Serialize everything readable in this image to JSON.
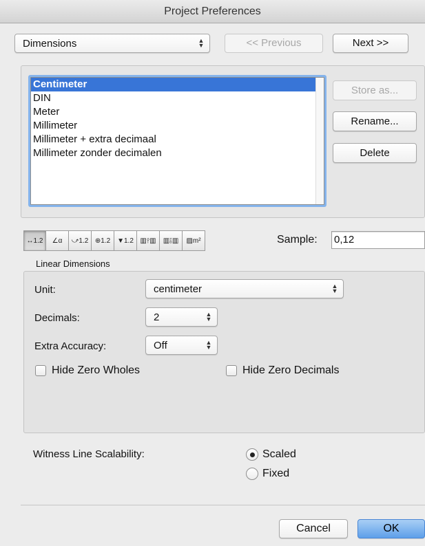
{
  "window": {
    "title": "Project Preferences"
  },
  "nav": {
    "category": "Dimensions",
    "previous_label": "<< Previous",
    "next_label": "Next >>"
  },
  "standards": {
    "items": [
      {
        "label": "Centimeter",
        "selected": true
      },
      {
        "label": "DIN",
        "selected": false
      },
      {
        "label": "Meter",
        "selected": false
      },
      {
        "label": "Millimeter",
        "selected": false
      },
      {
        "label": "Millimeter + extra decimaal",
        "selected": false
      },
      {
        "label": "Millimeter zonder decimalen",
        "selected": false
      }
    ],
    "store_as_label": "Store as...",
    "rename_label": "Rename...",
    "delete_label": "Delete"
  },
  "toolbar": {
    "tabs": [
      {
        "icon": "linear-dimension-icon",
        "glyph": "↔1.2",
        "active": true
      },
      {
        "icon": "angular-dimension-icon",
        "glyph": "∠α",
        "active": false
      },
      {
        "icon": "radial-dimension-icon",
        "glyph": "⤻1.2",
        "active": false
      },
      {
        "icon": "level-dimension-icon",
        "glyph": "⊕1.2",
        "active": false
      },
      {
        "icon": "elevation-dimension-icon",
        "glyph": "▼1.2",
        "active": false
      },
      {
        "icon": "door-window-dimension-icon",
        "glyph": "▥⫯▥",
        "active": false
      },
      {
        "icon": "sill-height-dimension-icon",
        "glyph": "▥⫱▥",
        "active": false
      },
      {
        "icon": "area-calculation-icon",
        "glyph": "▨m²",
        "active": false
      }
    ],
    "sample_label": "Sample:",
    "sample_value": "0,12"
  },
  "linear": {
    "section_title": "Linear Dimensions",
    "unit_label": "Unit:",
    "unit_value": "centimeter",
    "decimals_label": "Decimals:",
    "decimals_value": "2",
    "extra_accuracy_label": "Extra Accuracy:",
    "extra_accuracy_value": "Off",
    "hide_zero_wholes_label": "Hide Zero Wholes",
    "hide_zero_wholes_checked": false,
    "hide_zero_decimals_label": "Hide Zero Decimals",
    "hide_zero_decimals_checked": false
  },
  "witness": {
    "label": "Witness Line Scalability:",
    "scaled_label": "Scaled",
    "fixed_label": "Fixed",
    "selected": "Scaled"
  },
  "footer": {
    "cancel_label": "Cancel",
    "ok_label": "OK"
  },
  "colors": {
    "selection": "#3875d7",
    "focus_ring": "#85b4ec",
    "default_button": "#5e9fe9"
  }
}
